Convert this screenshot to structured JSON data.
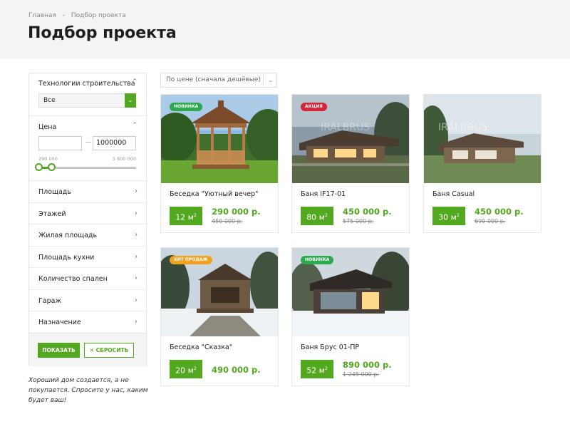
{
  "breadcrumb": {
    "home": "Главная",
    "separator": "-",
    "current": "Подбор проекта"
  },
  "page_title": "Подбор проекта",
  "filters": {
    "technology": {
      "label": "Технологии строительства",
      "value": "Все"
    },
    "price": {
      "label": "Цена",
      "min_value": "",
      "max_value": "1000000",
      "range_min": "290 000",
      "range_max": "5 600 000"
    },
    "rows": [
      "Площадь",
      "Этажей",
      "Жилая площадь",
      "Площадь кухни",
      "Количество спален",
      "Гараж",
      "Назначение"
    ],
    "show_label": "ПОКАЗАТЬ",
    "reset_label": "СБРОСИТЬ"
  },
  "quote": "Хороший дом создается, а не покупается. Спросите у нас, каким будет ваш!",
  "sort": {
    "value": "По цене (сначала дешёвые)"
  },
  "colors": {
    "accent": "#52a81e",
    "new": "#2eaa4e",
    "sale": "#d3243a",
    "hit": "#f2a11e"
  },
  "products": [
    {
      "badge": "НОВИНКА",
      "badge_type": "new",
      "title": "Беседка \"Уютный вечер\"",
      "area": "12 м",
      "area_sup": "2",
      "price": "290 000 р.",
      "old_price": "450 000 р."
    },
    {
      "badge": "АКЦИЯ",
      "badge_type": "sale",
      "title": "Баня IF17-01",
      "area": "80 м",
      "area_sup": "2",
      "price": "450 000 р.",
      "old_price": "575 000 р."
    },
    {
      "badge": "",
      "badge_type": "",
      "title": "Баня Casual",
      "area": "30 м",
      "area_sup": "2",
      "price": "450 000 р.",
      "old_price": "690 000 р."
    },
    {
      "badge": "ХИТ ПРОДАЖ",
      "badge_type": "hit",
      "title": "Беседка \"Сказка\"",
      "area": "20 м",
      "area_sup": "2",
      "price": "490 000 р.",
      "old_price": ""
    },
    {
      "badge": "НОВИНКА",
      "badge_type": "new",
      "title": "Баня Брус 01-ПР",
      "area": "52 м",
      "area_sup": "2",
      "price": "890 000 р.",
      "old_price": "1 245 000 р."
    }
  ]
}
